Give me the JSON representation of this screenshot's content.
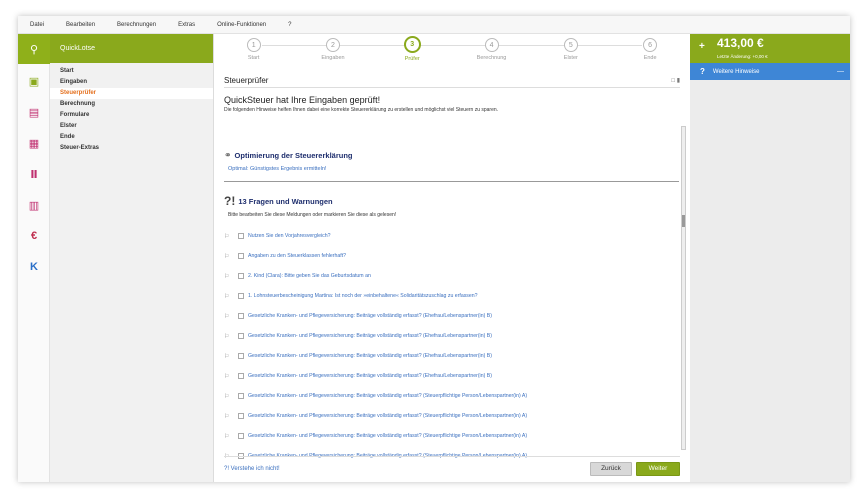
{
  "menu": [
    "Datei",
    "Bearbeiten",
    "Berechnungen",
    "Extras",
    "Online-Funktionen",
    "?"
  ],
  "rail": [
    {
      "icon": "search-icon",
      "glyph": "⚲"
    },
    {
      "icon": "chat-icon",
      "glyph": "▣"
    },
    {
      "icon": "form-icon",
      "glyph": "▤"
    },
    {
      "icon": "documents-icon",
      "glyph": "▦"
    },
    {
      "icon": "chart-icon",
      "glyph": "Ⅱ"
    },
    {
      "icon": "calculator-icon",
      "glyph": "▥"
    },
    {
      "icon": "euro-icon",
      "glyph": "€"
    },
    {
      "icon": "k-icon",
      "glyph": "K"
    }
  ],
  "lotse": {
    "title": "QuickLotse",
    "items": [
      "Start",
      "Eingaben",
      "Steuerprüfer",
      "Berechnung",
      "Formulare",
      "Elster",
      "Ende",
      "Steuer-Extras"
    ]
  },
  "steps": [
    {
      "num": "1",
      "label": "Start"
    },
    {
      "num": "2",
      "label": "Eingaben"
    },
    {
      "num": "3",
      "label": "Prüfer"
    },
    {
      "num": "4",
      "label": "Berechnung"
    },
    {
      "num": "5",
      "label": "Elster"
    },
    {
      "num": "6",
      "label": "Ende"
    }
  ],
  "panel": {
    "title": "Steuerprüfer",
    "headline": "QuickSteuer hat Ihre Eingaben geprüft!",
    "subline": "Die folgenden Hinweise helfen Ihnen dabei eine korrekte Steuererklärung zu erstellen und möglichst viel Steuern zu sparen.",
    "section1_title": "Optimierung der Steuererklärung",
    "section1_sub": "Optimal: Günstigstes Ergebnis ermitteln!",
    "section2_title": "13 Fragen und Warnungen",
    "section2_sub": "Bitte bearbeiten Sie diese Meldungen oder markieren Sie diese als gelesen!",
    "items": [
      "Nutzen Sie den Vorjahresvergleich?",
      "Angaben zu den Steuerklassen fehlerhaft?",
      "2. Kind (Clara): Bitte geben Sie das Geburtsdatum an",
      "1. Lohnsteuerbescheinigung Martina: Ist noch der »einbehaltene« Solidaritätszuschlag zu erfassen?",
      "Gesetzliche Kranken- und Pflegeversicherung: Beiträge vollständig erfasst? (Ehefrau/Lebenspartner(in) B)",
      "Gesetzliche Kranken- und Pflegeversicherung: Beiträge vollständig erfasst? (Ehefrau/Lebenspartner(in) B)",
      "Gesetzliche Kranken- und Pflegeversicherung: Beiträge vollständig erfasst? (Ehefrau/Lebenspartner(in) B)",
      "Gesetzliche Kranken- und Pflegeversicherung: Beiträge vollständig erfasst? (Ehefrau/Lebenspartner(in) B)",
      "Gesetzliche Kranken- und Pflegeversicherung: Beiträge vollständig erfasst? (Steuerpflichtige Person/Lebenspartner(in) A)",
      "Gesetzliche Kranken- und Pflegeversicherung: Beiträge vollständig erfasst? (Steuerpflichtige Person/Lebenspartner(in) A)",
      "Gesetzliche Kranken- und Pflegeversicherung: Beiträge vollständig erfasst? (Steuerpflichtige Person/Lebenspartner(in) A)",
      "Gesetzliche Kranken- und Pflegeversicherung: Beiträge vollständig erfasst? (Steuerpflichtige Person/Lebenspartner(in) A)"
    ],
    "help_link": "?! Verstehe ich nicht!",
    "back_label": "Zurück",
    "next_label": "Weiter"
  },
  "right": {
    "plus": "+",
    "amount": "413,00 €",
    "change": "Letzte Änderung: +0,00 €",
    "hints_q": "?",
    "hints_label": "Weitere Hinweise",
    "hints_minus": "—"
  },
  "colors": {
    "accent": "#8aa91c",
    "active_orange": "#e4701e",
    "link_blue": "#3a6fbf",
    "hints_blue": "#3e86d6"
  }
}
